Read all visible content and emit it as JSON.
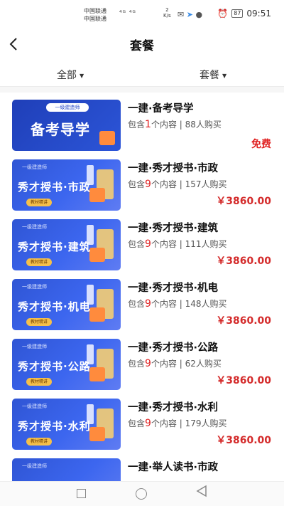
{
  "status": {
    "carrier1": "中国联通",
    "carrier2": "中国联通",
    "net": "⁴ᴳ ⁴ᴳ",
    "speed_value": "2",
    "speed_unit": "K/s",
    "battery": "87",
    "time": "09:51"
  },
  "nav": {
    "back_glyph": "‹",
    "title": "套餐"
  },
  "filters": {
    "left_label": "全部",
    "right_label": "套餐",
    "caret": "▼"
  },
  "items": [
    {
      "thumb_tag": "一级建造师",
      "thumb_text": "备考导学",
      "name": "一建·备考导学",
      "meta_prefix": "包含",
      "count": "1",
      "meta_suffix": "个内容 | 88人购买",
      "price": "免费"
    },
    {
      "thumb_tag": "一级建造师",
      "thumb_text": "秀才授书·市政",
      "pill": "教材精讲",
      "name": "一建·秀才授书·市政",
      "meta_prefix": "包含",
      "count": "9",
      "meta_suffix": "个内容 | 157人购买",
      "price": "￥3860.00"
    },
    {
      "thumb_tag": "一级建造师",
      "thumb_text": "秀才授书·建筑",
      "pill": "教材精讲",
      "name": "一建·秀才授书·建筑",
      "meta_prefix": "包含",
      "count": "9",
      "meta_suffix": "个内容 | 111人购买",
      "price": "￥3860.00"
    },
    {
      "thumb_tag": "一级建造师",
      "thumb_text": "秀才授书·机电",
      "pill": "教材精讲",
      "name": "一建·秀才授书·机电",
      "meta_prefix": "包含",
      "count": "9",
      "meta_suffix": "个内容 | 148人购买",
      "price": "￥3860.00"
    },
    {
      "thumb_tag": "一级建造师",
      "thumb_text": "秀才授书·公路",
      "pill": "教材精讲",
      "name": "一建·秀才授书·公路",
      "meta_prefix": "包含",
      "count": "9",
      "meta_suffix": "个内容 | 62人购买",
      "price": "￥3860.00"
    },
    {
      "thumb_tag": "一级建造师",
      "thumb_text": "秀才授书·水利",
      "pill": "教材精讲",
      "name": "一建·秀才授书·水利",
      "meta_prefix": "包含",
      "count": "9",
      "meta_suffix": "个内容 | 179人购买",
      "price": "￥3860.00"
    },
    {
      "thumb_tag": "一级建造师",
      "thumb_text": "",
      "name": "一建·举人读书·市政"
    }
  ],
  "colors": {
    "accent_red": "#d42b2b",
    "thumb_blue": "#3c66ef"
  }
}
